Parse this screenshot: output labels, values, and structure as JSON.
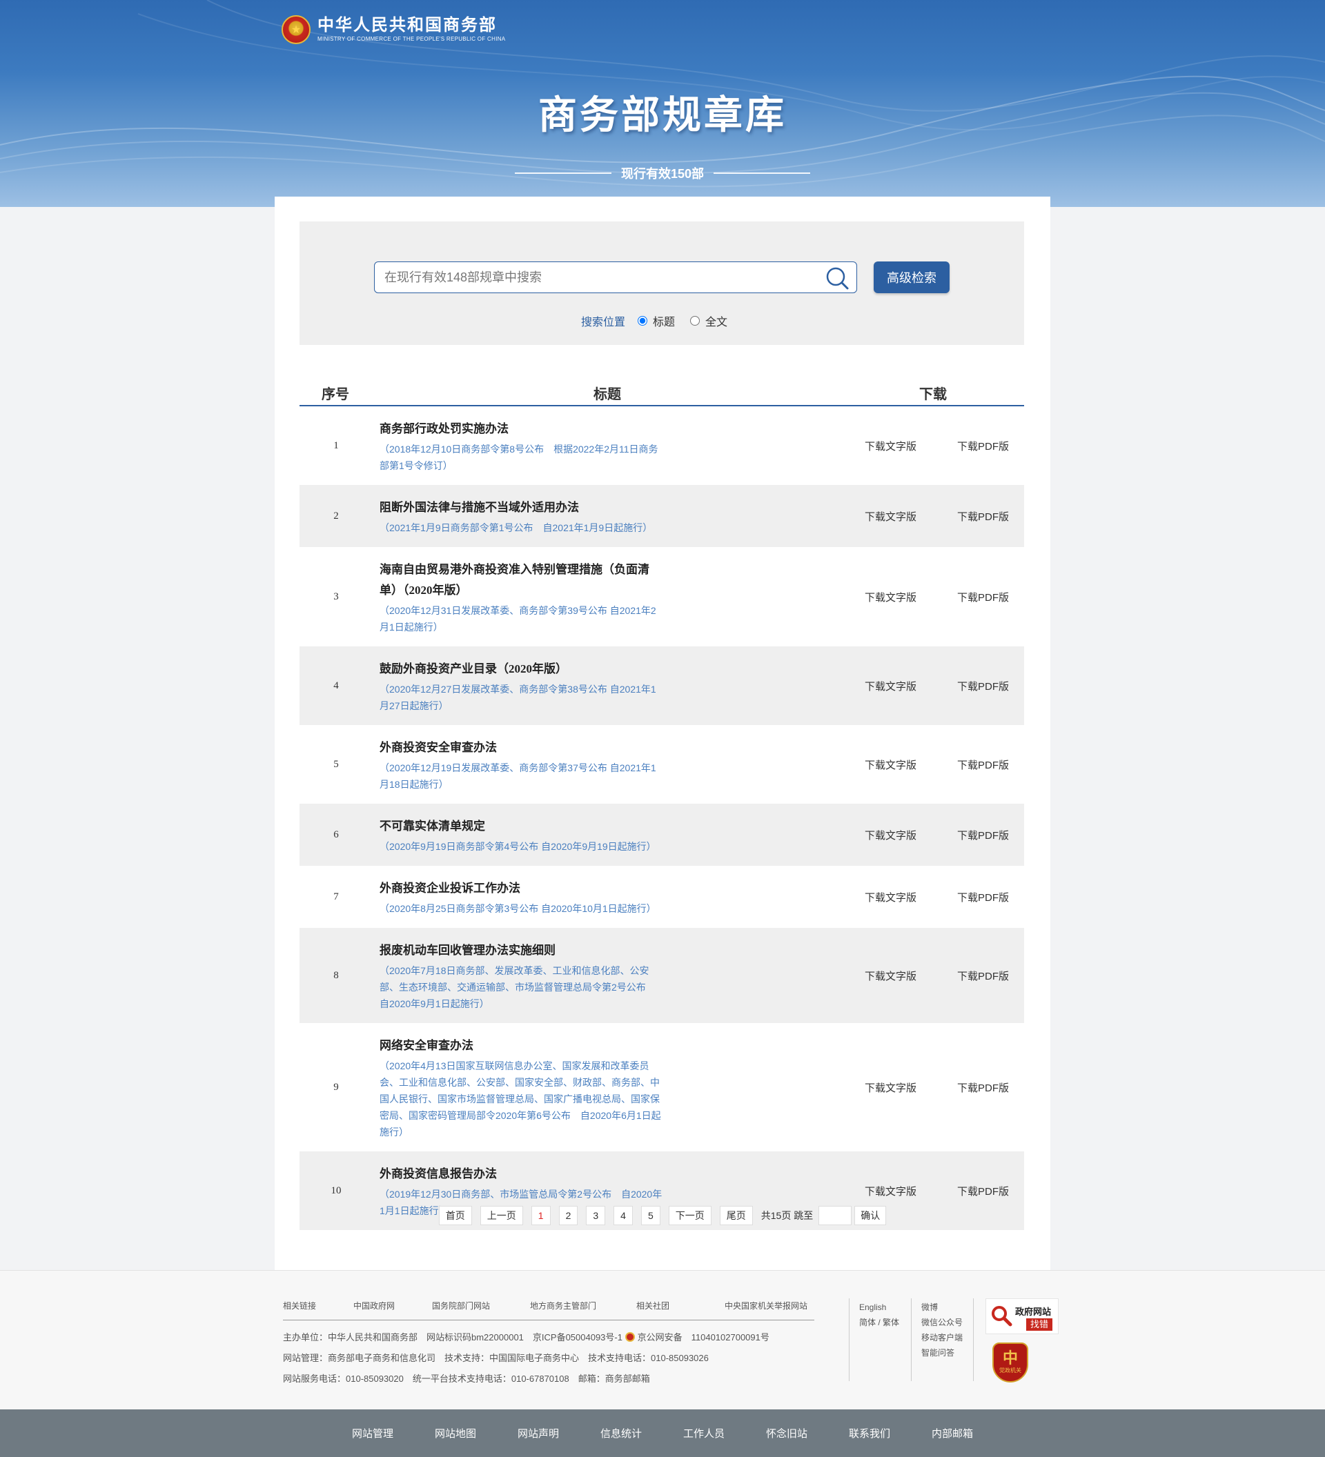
{
  "header": {
    "logo_cn": "中华人民共和国商务部",
    "logo_en": "MINISTRY OF COMMERCE OF THE PEOPLE'S REPUBLIC OF CHINA",
    "emblem_glyph": "★",
    "title": "商务部规章库",
    "subtitle": "现行有效150部"
  },
  "search": {
    "placeholder": "在现行有效148部规章中搜索",
    "value": "",
    "advanced_label": "高级检索",
    "position_label": "搜索位置",
    "options": [
      {
        "label": "标题",
        "checked": true
      },
      {
        "label": "全文",
        "checked": false
      }
    ]
  },
  "table": {
    "headers": {
      "num": "序号",
      "title": "标题",
      "download": "下载"
    },
    "download_text_label": "下载文字版",
    "download_pdf_label": "下载PDF版",
    "rows": [
      {
        "num": "1",
        "title": "商务部行政处罚实施办法",
        "sub": "（2018年12月10日商务部令第8号公布　根据2022年2月11日商务部第1号令修订）"
      },
      {
        "num": "2",
        "title": "阻断外国法律与措施不当域外适用办法",
        "sub": "（2021年1月9日商务部令第1号公布　自2021年1月9日起施行）"
      },
      {
        "num": "3",
        "title": "海南自由贸易港外商投资准入特别管理措施（负面清单）（2020年版）",
        "sub": "（2020年12月31日发展改革委、商务部令第39号公布 自2021年2月1日起施行）"
      },
      {
        "num": "4",
        "title": "鼓励外商投资产业目录（2020年版）",
        "sub": "（2020年12月27日发展改革委、商务部令第38号公布 自2021年1月27日起施行）"
      },
      {
        "num": "5",
        "title": "外商投资安全审查办法",
        "sub": "（2020年12月19日发展改革委、商务部令第37号公布 自2021年1月18日起施行）"
      },
      {
        "num": "6",
        "title": "不可靠实体清单规定",
        "sub": "（2020年9月19日商务部令第4号公布 自2020年9月19日起施行）"
      },
      {
        "num": "7",
        "title": "外商投资企业投诉工作办法",
        "sub": "（2020年8月25日商务部令第3号公布 自2020年10月1日起施行）"
      },
      {
        "num": "8",
        "title": "报废机动车回收管理办法实施细则",
        "sub": "（2020年7月18日商务部、发展改革委、工业和信息化部、公安部、生态环境部、交通运输部、市场监督管理总局令第2号公布　自2020年9月1日起施行）"
      },
      {
        "num": "9",
        "title": "网络安全审查办法",
        "sub": "（2020年4月13日国家互联网信息办公室、国家发展和改革委员会、工业和信息化部、公安部、国家安全部、财政部、商务部、中国人民银行、国家市场监督管理总局、国家广播电视总局、国家保密局、国家密码管理局部令2020年第6号公布　自2020年6月1日起施行）"
      },
      {
        "num": "10",
        "title": "外商投资信息报告办法",
        "sub": "（2019年12月30日商务部、市场监管总局令第2号公布　自2020年1月1日起施行）"
      }
    ]
  },
  "pagination": {
    "first": "首页",
    "prev": "上一页",
    "pages": [
      "1",
      "2",
      "3",
      "4",
      "5"
    ],
    "current": "1",
    "next": "下一页",
    "last": "尾页",
    "total_text": "共15页 跳至",
    "confirm": "确认"
  },
  "footer": {
    "links": [
      "相关链接",
      "中国政府网",
      "国务院部门网站",
      "地方商务主管部门",
      "相关社团",
      "中央国家机关举报网站"
    ],
    "info_line1": "主办单位：中华人民共和国商务部　网站标识码bm22000001　京ICP备05004093号-1",
    "police_text": "京公网安备　11040102700091号",
    "info_line2": "网站管理：商务部电子商务和信息化司　技术支持：中国国际电子商务中心　技术支持电话：010-85093026",
    "info_line3": "网站服务电话：010-85093020　统一平台技术支持电话：010-67870108　邮箱：商务部邮箱",
    "lang": [
      "English",
      "简体 / 繁体"
    ],
    "social": [
      "微博",
      "微信公众号",
      "移动客户端",
      "智能问答"
    ],
    "badge1_top": "政府网站",
    "badge1_bottom": "找错",
    "badge2_char": "中",
    "badge2_text": "党政机关"
  },
  "bottom_nav": [
    "网站管理",
    "网站地图",
    "网站声明",
    "信息统计",
    "工作人员",
    "怀念旧站",
    "联系我们",
    "内部邮箱"
  ]
}
